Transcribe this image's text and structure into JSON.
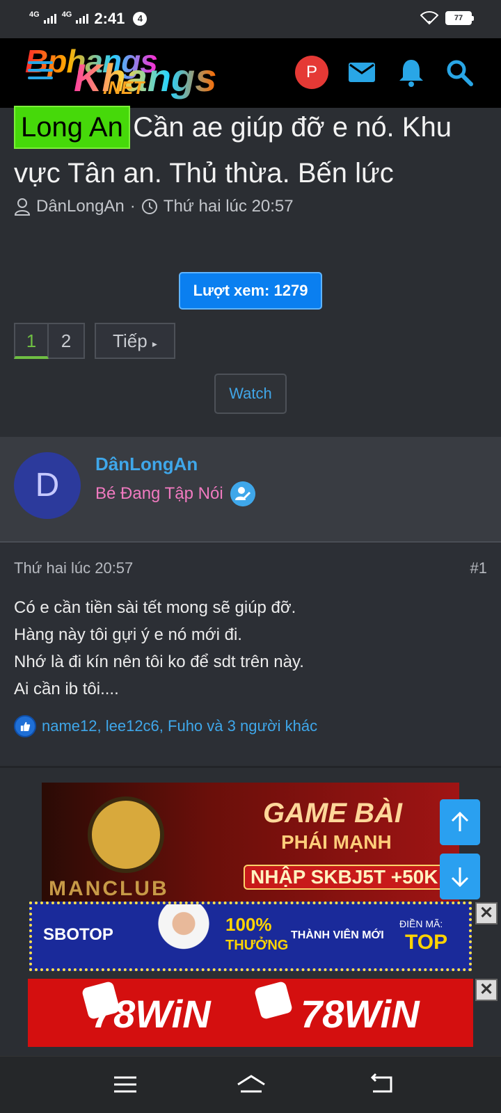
{
  "status_bar": {
    "network1": "4G",
    "network2": "4G",
    "time": "2:41",
    "notification_count": "4",
    "battery": "77"
  },
  "header": {
    "logo_top": "Bphangs",
    "logo_bottom": "Khangs",
    "logo_net": ".NET",
    "avatar_letter": "P"
  },
  "thread": {
    "prefix": "Long An",
    "title": "Cần ae giúp đỡ e nó. Khu vực Tân an. Thủ thừa. Bến lức",
    "author": "DânLongAn",
    "separator": "·",
    "date": "Thứ hai lúc 20:57",
    "views": "Lượt xem: 1279",
    "pages": [
      "1",
      "2"
    ],
    "next_label": "Tiếp",
    "watch_label": "Watch"
  },
  "user_card": {
    "avatar_letter": "D",
    "name": "DânLongAn",
    "title": "Bé Đang Tập Nói"
  },
  "post": {
    "date": "Thứ hai lúc 20:57",
    "number": "#1",
    "lines": [
      "Có e cần tiền sài tết mong sẽ giúp đỡ.",
      "Hàng này tôi gựi ý e nó mới đi.",
      "Nhớ là đi kín nên tôi ko để sdt trên này.",
      "Ai cần ib tôi...."
    ],
    "reactions": "name12, lee12c6, Fuho và 3 người khác"
  },
  "ads": {
    "game": {
      "headline": "GAME BÀI",
      "sub": "PHÁI MẠNH",
      "code": "NHẬP SKBJ5T +50K",
      "brand": "MANCLUB"
    },
    "sbo": {
      "brand": "SBOTOP",
      "percent": "100%",
      "bonus": "THƯỞNG",
      "member": "THÀNH VIÊN MỚI",
      "code_label": "ĐIỀN MÃ:",
      "code": "TOP"
    },
    "win": {
      "brand_left": "78WiN",
      "brand_right": "78WiN"
    },
    "close_symbol": "✕"
  },
  "colors": {
    "accent": "#3fa7ea",
    "prefix_bg": "#46d90a",
    "views_bg": "#0a7ff0",
    "user_title": "#f07ac0",
    "page_bg": "#2b2e33"
  }
}
